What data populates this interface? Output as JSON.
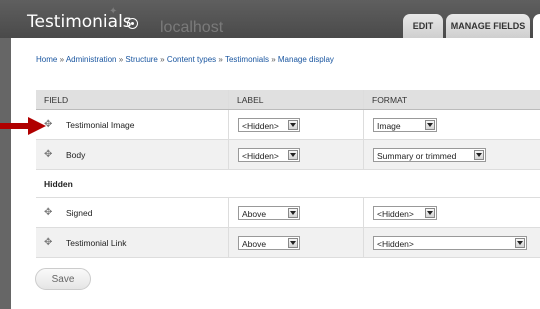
{
  "header": {
    "site_title": "Testimonials",
    "ghost_text": "localhost",
    "tabs": [
      {
        "label": "EDIT"
      },
      {
        "label": "MANAGE FIELDS"
      }
    ]
  },
  "breadcrumb": {
    "items": [
      "Home",
      "Administration",
      "Structure",
      "Content types",
      "Testimonials",
      "Manage display"
    ],
    "separator": "»"
  },
  "table": {
    "headers": {
      "field": "FIELD",
      "label": "LABEL",
      "format": "FORMAT"
    },
    "rows": [
      {
        "field": "Testimonial Image",
        "label": "<Hidden>",
        "format": "Image"
      },
      {
        "field": "Body",
        "label": "<Hidden>",
        "format": "Summary or trimmed"
      }
    ],
    "hidden_region": {
      "title": "Hidden"
    },
    "hidden_rows": [
      {
        "field": "Signed",
        "label": "Above",
        "format": "<Hidden>"
      },
      {
        "field": "Testimonial Link",
        "label": "Above",
        "format": "<Hidden>"
      }
    ]
  },
  "actions": {
    "save_label": "Save"
  },
  "colors": {
    "link": "#1a56a0",
    "arrow": "#b00000",
    "header_bg": "#4a4a4a"
  },
  "icons": [
    "shortcut-star-icon",
    "drag-handle-icon",
    "dropdown-arrow-icon",
    "pointer-arrow-icon"
  ]
}
